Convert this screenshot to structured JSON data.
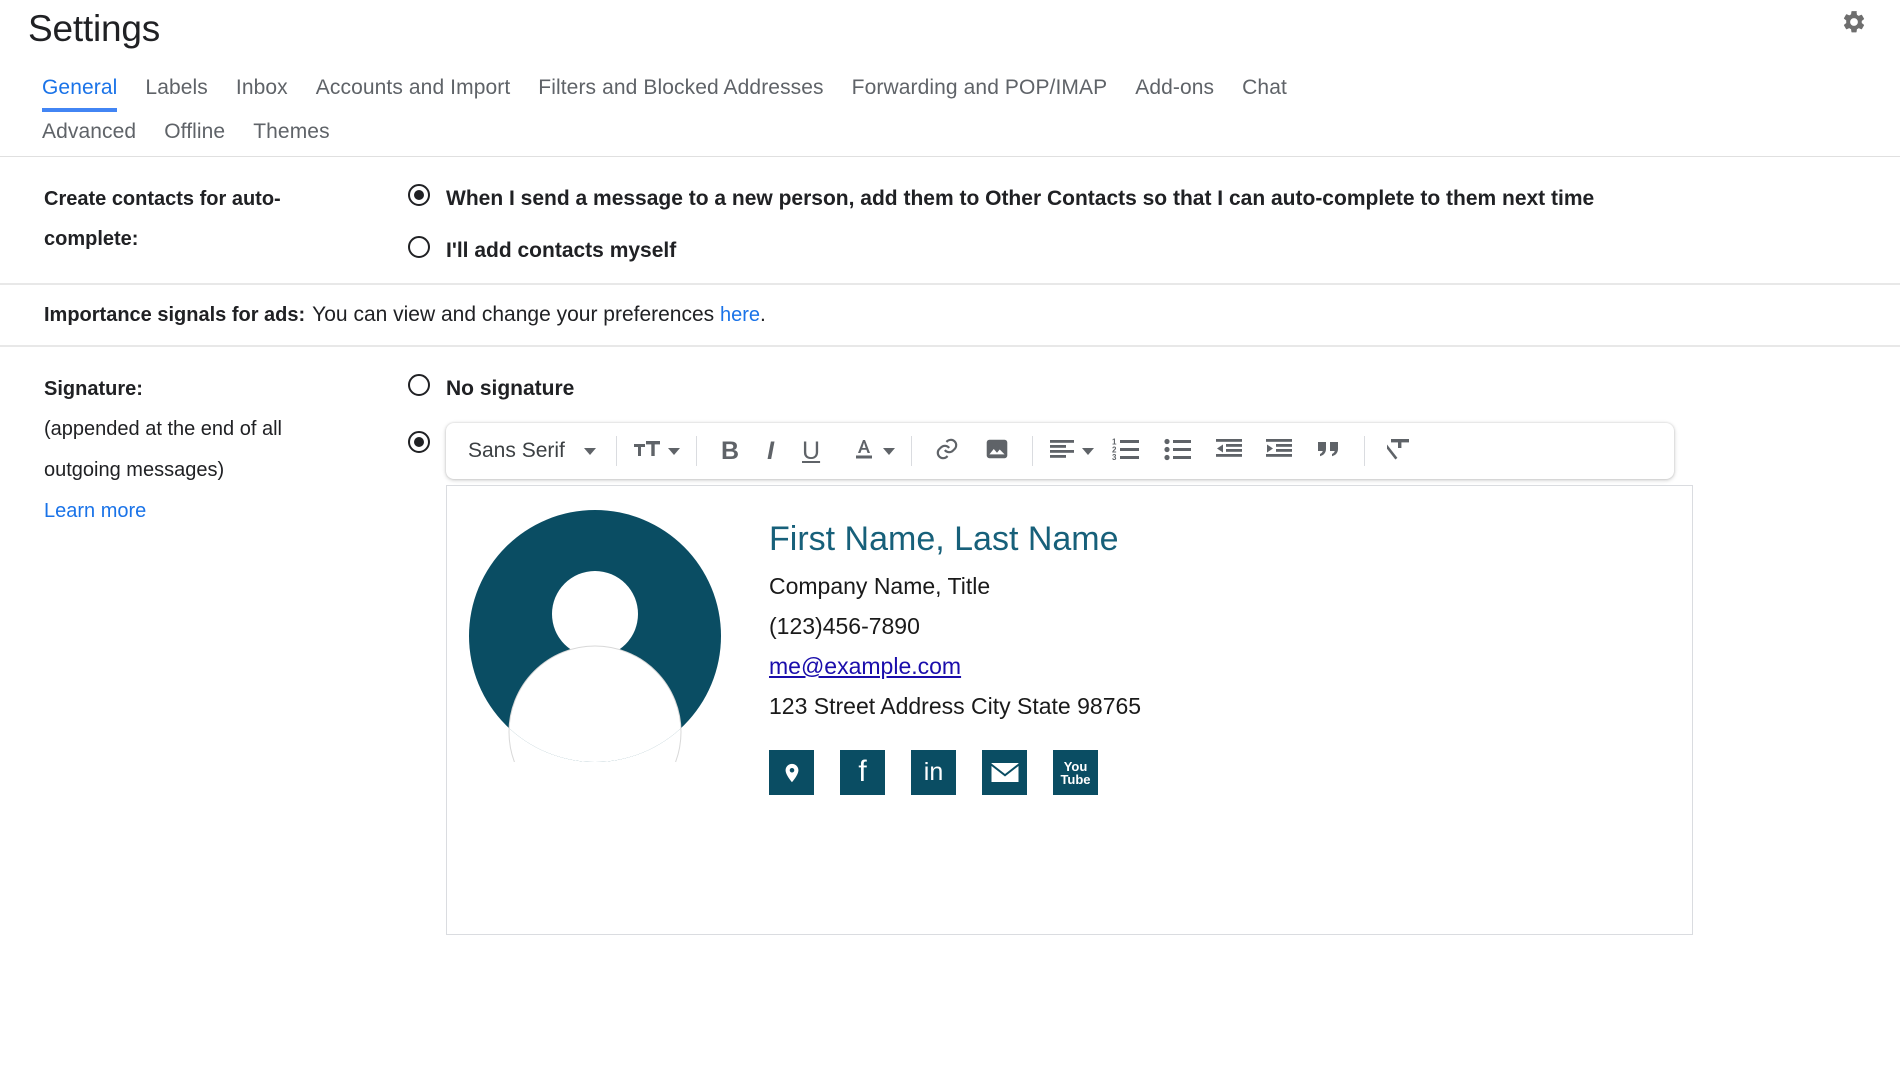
{
  "header": {
    "title": "Settings",
    "gear_icon": "gear-icon"
  },
  "tabs": {
    "row1": [
      {
        "label": "General",
        "active": true
      },
      {
        "label": "Labels",
        "active": false
      },
      {
        "label": "Inbox",
        "active": false
      },
      {
        "label": "Accounts and Import",
        "active": false
      },
      {
        "label": "Filters and Blocked Addresses",
        "active": false
      },
      {
        "label": "Forwarding and POP/IMAP",
        "active": false
      },
      {
        "label": "Add-ons",
        "active": false
      },
      {
        "label": "Chat",
        "active": false
      }
    ],
    "row2": [
      {
        "label": "Advanced",
        "active": false
      },
      {
        "label": "Offline",
        "active": false
      },
      {
        "label": "Themes",
        "active": false
      }
    ]
  },
  "autocomplete": {
    "label_line1": "Create contacts for auto-",
    "label_line2": "complete:",
    "option1": "When I send a message to a new person, add them to Other Contacts so that I can auto-complete to them next time",
    "option1_selected": true,
    "option2": "I'll add contacts myself",
    "option2_selected": false
  },
  "ads": {
    "label": "Importance signals for ads:",
    "text_before": "You can view and change your preferences ",
    "link": "here",
    "text_after": "."
  },
  "signature": {
    "label": "Signature:",
    "sub_line1": "(appended at the end of all",
    "sub_line2": "outgoing messages)",
    "learn_more": "Learn more",
    "no_signature": "No signature",
    "no_signature_selected": false,
    "editor_selected": true,
    "toolbar": {
      "font_name": "Sans Serif",
      "font_caret": "chevron-down-icon",
      "text_size_icon": "text-size-icon",
      "text_size_caret": "chevron-down-icon",
      "bold": "B",
      "italic": "I",
      "underline": "U",
      "text_color_icon": "text-color-icon",
      "text_color_caret": "chevron-down-icon",
      "link_icon": "link-icon",
      "image_icon": "insert-image-icon",
      "align_icon": "align-left-icon",
      "align_caret": "chevron-down-icon",
      "numbered_list_icon": "numbered-list-icon",
      "bulleted_list_icon": "bulleted-list-icon",
      "indent_less_icon": "indent-less-icon",
      "indent_more_icon": "indent-more-icon",
      "quote_icon": "block-quote-icon",
      "remove_format_icon": "remove-formatting-icon"
    },
    "content": {
      "avatar_alt": "person-avatar",
      "name": "First Name, Last Name",
      "company": "Company Name, Title",
      "phone": "(123)456-7890",
      "email": "me@example.com",
      "address": "123 Street Address City State 98765",
      "social": [
        {
          "name": "map-pin-icon",
          "type": "pin"
        },
        {
          "name": "facebook-icon",
          "type": "facebook",
          "glyph": "f"
        },
        {
          "name": "linkedin-icon",
          "type": "linkedin",
          "glyph": "in"
        },
        {
          "name": "email-icon",
          "type": "email"
        },
        {
          "name": "youtube-icon",
          "type": "youtube",
          "glyph_line1": "You",
          "glyph_line2": "Tube"
        }
      ]
    }
  },
  "colors": {
    "accent_blue": "#1a73e8",
    "tab_underline": "#4285f4",
    "brand_teal": "#0a4d63",
    "name_teal": "#17607a",
    "link_purple": "#1a0dab",
    "text": "#202124",
    "muted": "#5f6368",
    "border": "#e0e0e0"
  }
}
